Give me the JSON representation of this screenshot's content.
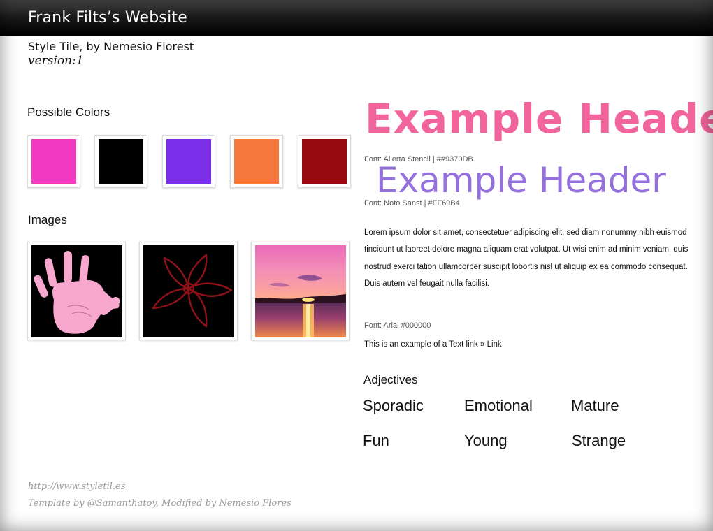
{
  "header": {
    "site_title": "Frank Filts’s Website",
    "subtitle": "Style Tile, by Nemesio Florest",
    "version": "version:1"
  },
  "colors_section": {
    "heading": "Possible Colors",
    "swatches": [
      {
        "name": "magenta",
        "color": "#F239C2"
      },
      {
        "name": "black",
        "color": "#000000"
      },
      {
        "name": "violet",
        "color": "#7A2EE8"
      },
      {
        "name": "orange",
        "color": "#F5773B"
      },
      {
        "name": "dark-red",
        "color": "#960A10"
      }
    ]
  },
  "images_section": {
    "heading": "Images",
    "images": [
      {
        "name": "pink-handprint",
        "icon": "handprint-image"
      },
      {
        "name": "dark-red-flower-outline",
        "icon": "flower-outline-image"
      },
      {
        "name": "pink-sunset-over-water",
        "icon": "sunset-image"
      }
    ]
  },
  "typography": {
    "header_1": {
      "text": "Example Header",
      "color": "#F2649C",
      "font_note": "Font: Allerta Stencil |  ##9370DB"
    },
    "header_2": {
      "text": "Example Header",
      "color": "#9370DB",
      "font_note": "Font: Noto Sanst  |  #FF69B4"
    },
    "body_text": "Lorem ipsum dolor sit amet, consectetuer adipiscing elit, sed diam nonummy nibh euismod tincidunt ut laoreet dolore magna aliquam erat volutpat. Ut wisi enim ad minim veniam, quis nostrud exerci tation ullamcorper suscipit lobortis nisl ut aliquip ex ea commodo consequat. Duis autem vel feugait nulla facilisi.",
    "body_font_note": "Font: Arial #000000",
    "text_link": "This is an example of a Text link » Link"
  },
  "adjectives_section": {
    "heading": "Adjectives",
    "words": [
      "Sporadic",
      "Emotional",
      "Mature",
      "Fun",
      "Young",
      "Strange"
    ]
  },
  "footer": {
    "url": "http://www.styletil.es",
    "credit": "Template by @Samanthatoy, Modified by Nemesio Flores"
  }
}
